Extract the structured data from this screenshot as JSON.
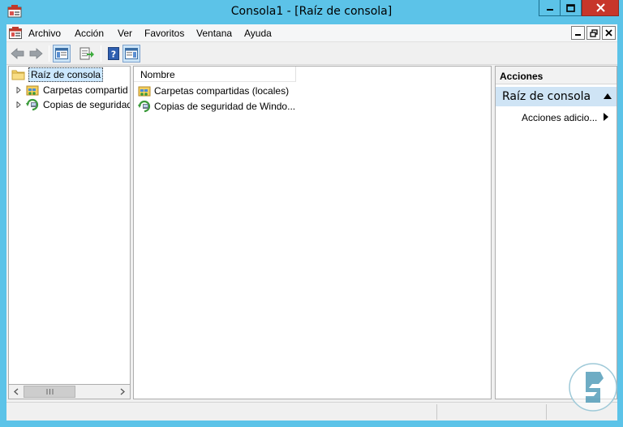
{
  "window": {
    "title": "Consola1 - [Raíz de consola]"
  },
  "menu": {
    "items": [
      "Archivo",
      "Acción",
      "Ver",
      "Favoritos",
      "Ventana",
      "Ayuda"
    ]
  },
  "toolbar": {
    "buttons": [
      "back-arrow-icon",
      "forward-arrow-icon",
      "show-hide-tree-icon",
      "export-list-icon",
      "help-icon",
      "show-hide-action-pane-icon"
    ]
  },
  "tree": {
    "root_label": "Raíz de consola",
    "items": [
      {
        "label": "Carpetas compartid",
        "icon": "shared-folders-icon"
      },
      {
        "label": "Copias de seguridad",
        "icon": "windows-backup-icon"
      }
    ]
  },
  "list": {
    "columns": [
      "Nombre"
    ],
    "rows": [
      {
        "name": "Carpetas compartidas (locales)",
        "icon": "shared-folders-icon"
      },
      {
        "name": "Copias de seguridad de Windo...",
        "icon": "windows-backup-icon"
      }
    ]
  },
  "actions": {
    "header": "Acciones",
    "section_title": "Raíz de consola",
    "items": [
      {
        "label": "Acciones adicio..."
      }
    ]
  },
  "colors": {
    "window_chrome": "#5cc3e8",
    "close_button": "#c7362a",
    "action_section_bg": "#cfe4f5",
    "tree_selection": "#cce8ff"
  }
}
